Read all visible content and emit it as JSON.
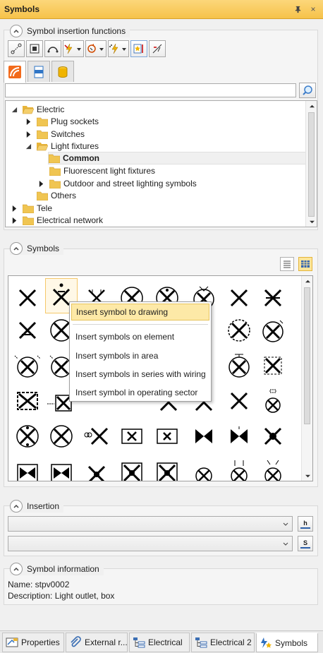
{
  "window": {
    "title": "Symbols",
    "pin_label": "ᵖ",
    "close_label": "×"
  },
  "sections": {
    "functions": "Symbol insertion functions",
    "symbols": "Symbols",
    "insertion": "Insertion",
    "info": "Symbol information"
  },
  "search": {
    "value": "",
    "placeholder": ""
  },
  "tree": {
    "items": [
      {
        "label": "Electric",
        "level": 0,
        "state": "expanded"
      },
      {
        "label": "Plug sockets",
        "level": 1,
        "state": "collapsed"
      },
      {
        "label": "Switches",
        "level": 1,
        "state": "collapsed"
      },
      {
        "label": "Light fixtures",
        "level": 1,
        "state": "expanded"
      },
      {
        "label": "Common",
        "level": 2,
        "state": "leaf",
        "selected": true
      },
      {
        "label": "Fluorescent light fixtures",
        "level": 2,
        "state": "leaf"
      },
      {
        "label": "Outdoor and street lighting symbols",
        "level": 2,
        "state": "collapsed"
      },
      {
        "label": "Others",
        "level": 1,
        "state": "leaf"
      },
      {
        "label": "Tele",
        "level": 0,
        "state": "collapsed"
      },
      {
        "label": "Electrical network",
        "level": 0,
        "state": "collapsed"
      }
    ]
  },
  "context_menu": {
    "items": [
      "Insert symbol to drawing",
      "Insert symbols on element",
      "Insert symbols in area",
      "Insert symbols in series with wiring",
      "Insert symbol in operating sector"
    ]
  },
  "insertion": {
    "height_btn": "h",
    "scale_btn": "S",
    "combo1_value": "",
    "combo2_value": ""
  },
  "info": {
    "name": "Name: stpv0002",
    "description": "Description: Light outlet, box"
  },
  "bottom_tabs": [
    {
      "label": "Properties",
      "icon": "properties-icon"
    },
    {
      "label": "External r...",
      "icon": "paperclip-icon"
    },
    {
      "label": "Electrical",
      "icon": "tree-icon"
    },
    {
      "label": "Electrical 2",
      "icon": "tree-icon"
    },
    {
      "label": "Symbols",
      "icon": "symbols-icon",
      "active": true
    }
  ],
  "colors": {
    "title_bar": "#f6c24a",
    "highlight": "#fde9a7",
    "folder": "#e8b53a"
  }
}
